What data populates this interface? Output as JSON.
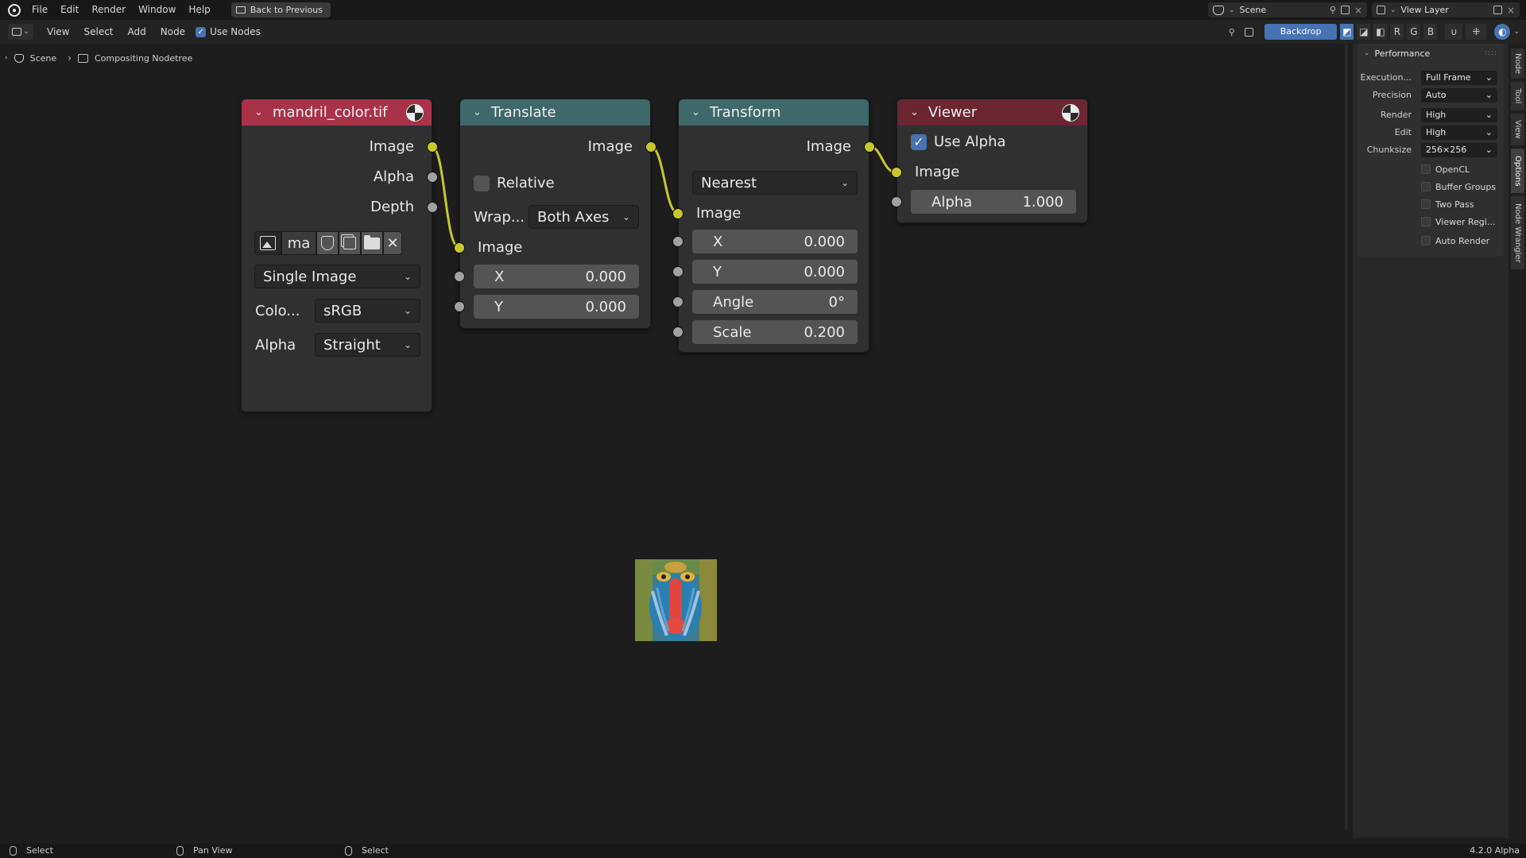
{
  "topbar": {
    "menus": [
      "File",
      "Edit",
      "Render",
      "Window",
      "Help"
    ],
    "back_button": "Back to Previous",
    "scene": "Scene",
    "view_layer": "View Layer"
  },
  "header": {
    "menus": [
      "View",
      "Select",
      "Add",
      "Node"
    ],
    "use_nodes": "Use Nodes",
    "backdrop": "Backdrop",
    "channels": [
      "R",
      "G",
      "B"
    ]
  },
  "breadcrumb": {
    "scene": "Scene",
    "tree": "Compositing Nodetree"
  },
  "nodes": {
    "image": {
      "title": "mandril_color.tif",
      "header_color": "#a83349",
      "outputs": [
        "Image",
        "Alpha",
        "Depth"
      ],
      "datablock": "ma",
      "source": "Single Image",
      "color_label": "Colo...",
      "color_value": "sRGB",
      "alpha_label": "Alpha",
      "alpha_value": "Straight"
    },
    "translate": {
      "title": "Translate",
      "header_color": "#3e6869",
      "output": "Image",
      "relative": "Relative",
      "wrap_label": "Wrap...",
      "wrap_value": "Both Axes",
      "input": "Image",
      "x_label": "X",
      "x_value": "0.000",
      "y_label": "Y",
      "y_value": "0.000"
    },
    "transform": {
      "title": "Transform",
      "header_color": "#3e6869",
      "output": "Image",
      "filter": "Nearest",
      "input": "Image",
      "x_label": "X",
      "x_value": "0.000",
      "y_label": "Y",
      "y_value": "0.000",
      "angle_label": "Angle",
      "angle_value": "0°",
      "scale_label": "Scale",
      "scale_value": "0.200"
    },
    "viewer": {
      "title": "Viewer",
      "header_color": "#6b2631",
      "use_alpha": "Use Alpha",
      "input": "Image",
      "alpha_label": "Alpha",
      "alpha_value": "1.000"
    }
  },
  "sidebar": {
    "panel_title": "Performance",
    "props": [
      {
        "label": "Execution...",
        "value": "Full Frame"
      },
      {
        "label": "Precision",
        "value": "Auto"
      },
      {
        "label": "Render",
        "value": "High"
      },
      {
        "label": "Edit",
        "value": "High"
      },
      {
        "label": "Chunksize",
        "value": "256×256"
      }
    ],
    "checks": [
      "OpenCL",
      "Buffer Groups",
      "Two Pass",
      "Viewer Regi...",
      "Auto Render"
    ],
    "tabs": [
      "Node",
      "Tool",
      "View",
      "Options",
      "Node Wrangler"
    ]
  },
  "status": {
    "left": "Select",
    "middle": "Pan View",
    "right": "Select",
    "version": "4.2.0 Alpha"
  },
  "colors": {
    "accent": "#4772b3",
    "socket_image": "#c7c729",
    "socket_value": "#a1a1a1",
    "link": "#c7c729"
  }
}
